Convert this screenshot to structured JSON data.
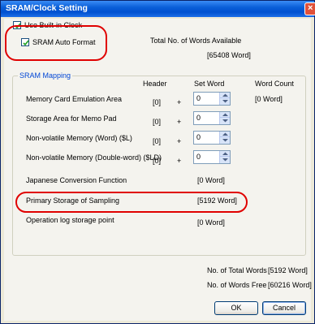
{
  "title": "SRAM/Clock Setting",
  "options": {
    "use_builtin_clock": {
      "label": "Use Built-in Clock",
      "checked": true
    },
    "sram_auto_format": {
      "label": "SRAM Auto Format",
      "checked": true
    }
  },
  "available": {
    "label": "Total No. of Words Available",
    "value": "[65408 Word]"
  },
  "mapping": {
    "title": "SRAM Mapping",
    "headers": {
      "header": "Header",
      "set_word": "Set Word",
      "word_count": "Word Count"
    },
    "rows": [
      {
        "label": "Memory Card Emulation Area",
        "header": "[0]",
        "plus": "+",
        "set_word": "0",
        "count": "[0 Word]"
      },
      {
        "label": "Storage Area for Memo Pad",
        "header": "[0]",
        "plus": "+",
        "set_word": "0",
        "count": ""
      },
      {
        "label": "Non-volatile Memory (Word) ($L)",
        "header": "[0]",
        "plus": "+",
        "set_word": "0",
        "count": ""
      },
      {
        "label": "Non-volatile Memory (Double-word) ($LD)",
        "header": "[0]",
        "plus": "+",
        "set_word": "0",
        "count": ""
      }
    ],
    "japanese": {
      "label": "Japanese Conversion Function",
      "count": "[0 Word]"
    },
    "sampling": {
      "label": "Primary Storage of Sampling",
      "count": "[5192 Word]"
    },
    "oplog": {
      "label": "Operation log storage point",
      "count": "[0 Word]"
    }
  },
  "totals": {
    "total_label": "No. of Total Words",
    "total_value": "[5192 Word]",
    "free_label": "No. of Words Free",
    "free_value": "[60216 Word]"
  },
  "buttons": {
    "ok": "OK",
    "cancel": "Cancel"
  },
  "colors": {
    "highlight": "#e00000",
    "titlebar": "#0a5fd8",
    "group_title": "#0046d5"
  }
}
